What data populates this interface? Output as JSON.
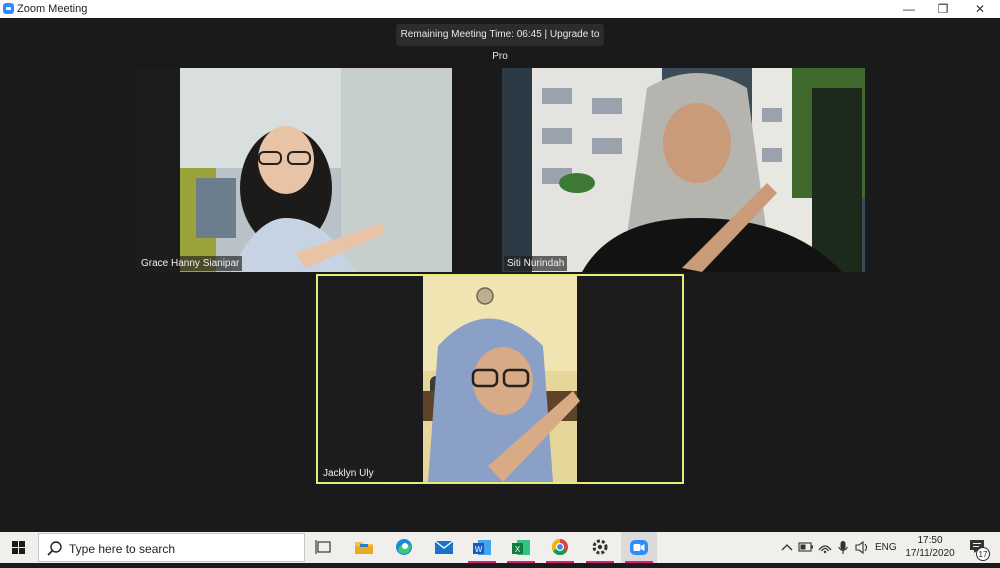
{
  "window": {
    "title": "Zoom Meeting",
    "minimize": "—",
    "restore": "❐",
    "close": "✕"
  },
  "meeting": {
    "timer_text": "Remaining Meeting Time: 06:45 | Upgrade to Pro",
    "participants": [
      {
        "name": "Grace Hanny Sianipar"
      },
      {
        "name": "Siti Nurindah"
      },
      {
        "name": "Jacklyn Uly"
      }
    ],
    "active_speaker_color": "#e6eb7a"
  },
  "taskbar": {
    "search_placeholder": "Type here to search",
    "pinned": [
      "task-view",
      "file-explorer",
      "edge",
      "mail",
      "word",
      "excel",
      "chrome",
      "settings",
      "zoom"
    ],
    "tray": {
      "language": "ENG",
      "time": "17:50",
      "date": "17/11/2020",
      "notification_count": "17"
    },
    "accent": "#d41e7a"
  }
}
